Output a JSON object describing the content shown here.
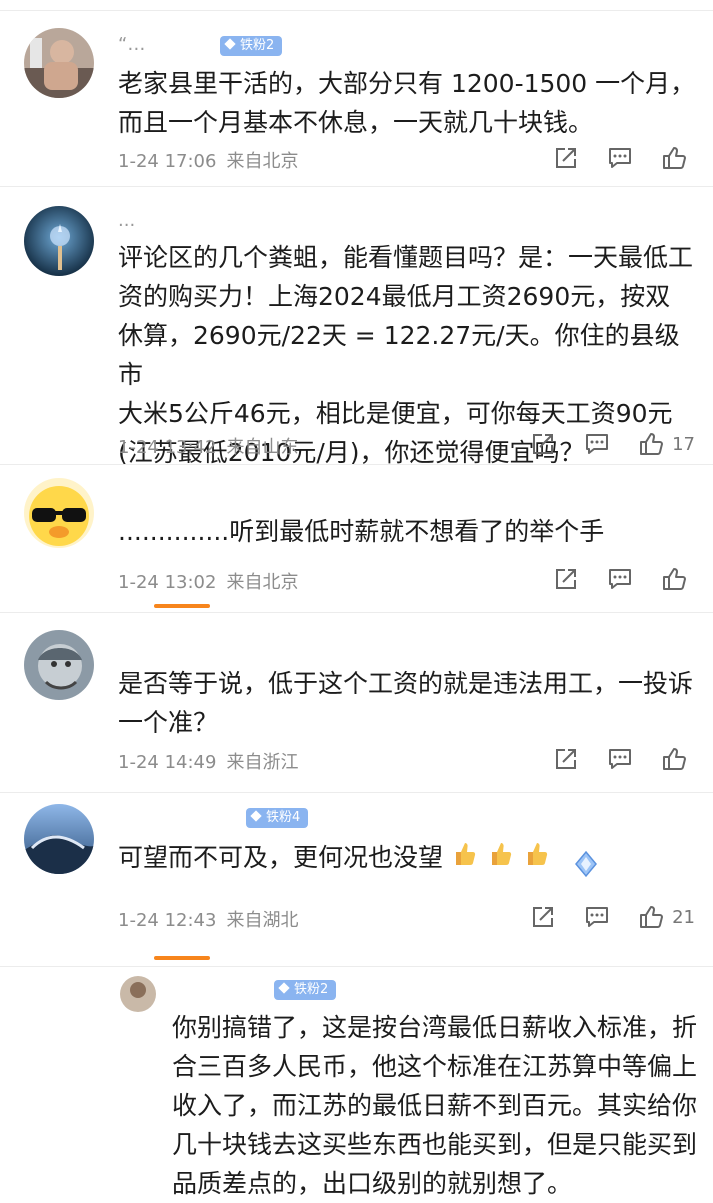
{
  "comments": [
    {
      "name": "“…",
      "badge": "铁粉2",
      "text": "老家县里干活的，大部分只有 1200-1500 一个月，\n而且一个月基本不休息，一天就几十块钱。",
      "time": "1-24 17:06",
      "location": "来自北京",
      "likes": ""
    },
    {
      "name": "...",
      "badge": "",
      "text": "评论区的几个粪蛆，能看懂题目吗？是：一天最低工\n资的购买力！上海2024最低月工资2690元，按双\n休算，2690元/22天 = 122.27元/天。你住的县级市\n大米5公斤46元，相比是便宜，可你每天工资90元\n(江苏最低2010元/月)，你还觉得便宜吗？",
      "time": "1-24 13:42",
      "location": "来自山东",
      "likes": "17"
    },
    {
      "name": "",
      "badge": "",
      "text": "..............听到最低时薪就不想看了的举个手",
      "time": "1-24 13:02",
      "location": "来自北京",
      "likes": ""
    },
    {
      "name": "",
      "badge": "",
      "text": "是否等于说，低于这个工资的就是违法用工，一投诉\n一个准？",
      "time": "1-24 14:49",
      "location": "来自浙江",
      "likes": ""
    },
    {
      "name": "",
      "badge": "铁粉4",
      "text": "可望而不可及，更何况也没望",
      "time": "1-24 12:43",
      "location": "来自湖北",
      "likes": "21"
    }
  ],
  "reply": {
    "badge": "铁粉2",
    "text": "你别搞错了，这是按台湾最低日薪收入标准，折\n合三百多人民币，他这个标准在江苏算中等偏上\n收入了，而江苏的最低日薪不到百元。其实给你\n几十块钱去这买些东西也能买到，但是只能买到\n品质差点的，出口级别的就别想了。"
  },
  "icons": {
    "share": "share-icon",
    "comment": "comment-icon",
    "like": "thumbs-up-icon"
  },
  "colors": {
    "badge": "#8ab4f0",
    "accent": "#f7851c"
  }
}
